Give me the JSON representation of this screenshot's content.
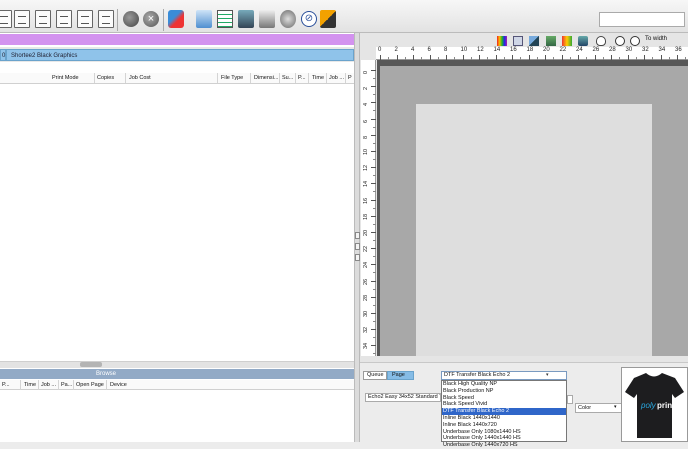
{
  "left_tabs": [
    "0",
    "Shortee2 Black Graphics"
  ],
  "queue_columns": [
    "Print Mode",
    "Copies",
    "Job Cost",
    "File Type",
    "Dimensi...",
    "Su...",
    "P...",
    "Time",
    "Job ...",
    "P"
  ],
  "browse": {
    "label": "Browse",
    "columns": [
      "P...",
      "Time",
      "Job ...",
      "Pa...",
      "Open Page",
      "Device"
    ]
  },
  "ruler": {
    "h_numbers": [
      "0",
      "2",
      "4",
      "6",
      "8",
      "10",
      "12",
      "14",
      "16",
      "18",
      "20",
      "22",
      "24",
      "26",
      "28",
      "30",
      "32",
      "34",
      "36",
      "38",
      "40"
    ],
    "v_numbers": [
      "0",
      "2",
      "4",
      "6",
      "8",
      "10",
      "12",
      "14",
      "16",
      "18",
      "20",
      "22",
      "24",
      "26",
      "28",
      "30",
      "32",
      "34"
    ]
  },
  "zoom_label": "To width",
  "bottom_right": {
    "tab_queue": "Queue",
    "tab_page": "Page",
    "print_mode_selected": "DTF Transfer Black Echo 2",
    "print_mode_options": [
      "Black High Quality NP",
      "Black Production NP",
      "Black Speed",
      "Black Speed Vivid",
      "DTF Transfer Black Echo 2",
      "Inline Black 1440x1440",
      "Inline Black 1440x720",
      "Underbase Only 1080x1440 HS",
      "Underbase Only 1440x1440 HS",
      "Underbase Only 1440x720 HS"
    ],
    "selected_option_index": 4,
    "media_field": "Echo2 Easy 34x52 Standard To",
    "color_select": "Color"
  },
  "thumbnail_logo": {
    "part1": "poly",
    "part2": "print"
  },
  "colors": {
    "purple_bar": "#d392ef",
    "tab_blue": "#8fc3ea",
    "browse_bar": "#92aac6",
    "selection": "#2f66c9",
    "canvas_dark": "#575757"
  }
}
